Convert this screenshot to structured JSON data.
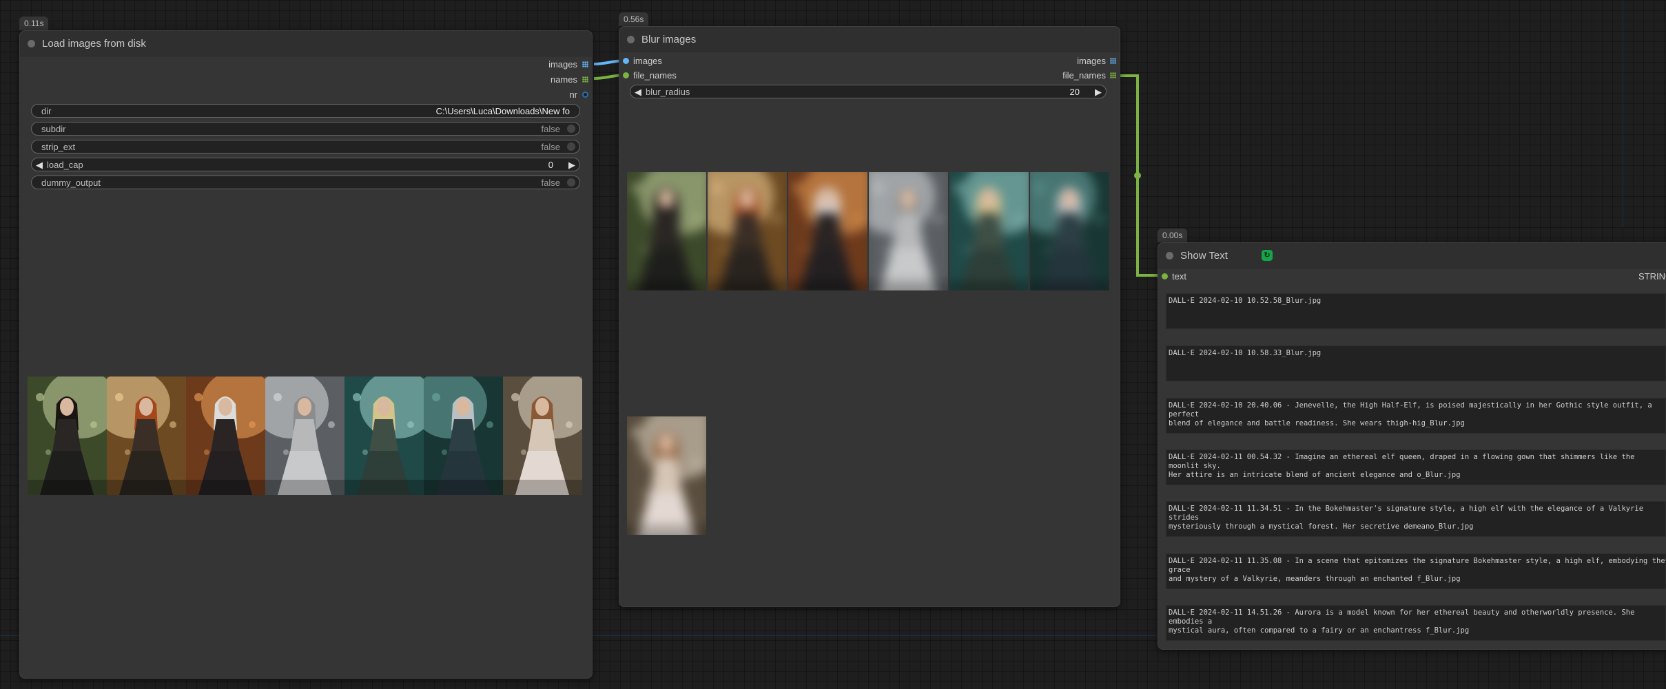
{
  "load_node": {
    "timing": "0.11s",
    "title": "Load images from disk",
    "outputs": [
      {
        "label": "images",
        "color": "#64b5f6"
      },
      {
        "label": "names",
        "color": "#7cb342"
      },
      {
        "label": "nr",
        "color": "#2a6fb0"
      }
    ],
    "widgets": {
      "dir": {
        "label": "dir",
        "value": "C:\\Users\\Luca\\Downloads\\New fo"
      },
      "subdir": {
        "label": "subdir",
        "value": "false"
      },
      "strip_ext": {
        "label": "strip_ext",
        "value": "false"
      },
      "load_cap": {
        "label": "load_cap",
        "value": "0"
      },
      "dummy_output": {
        "label": "dummy_output",
        "value": "false"
      }
    },
    "preview_count": 7
  },
  "blur_node": {
    "timing": "0.56s",
    "title": "Blur images",
    "inputs": [
      {
        "label": "images"
      },
      {
        "label": "file_names"
      }
    ],
    "outputs": [
      {
        "label": "images"
      },
      {
        "label": "file_names"
      }
    ],
    "widgets": {
      "blur_radius": {
        "label": "blur_radius",
        "value": "20"
      }
    },
    "preview_count": 7
  },
  "show_text_node": {
    "timing": "0.00s",
    "title": "Show Text",
    "badge_icon": "custom-scripts-icon",
    "input_label": "text",
    "output_label": "STRING",
    "texts": [
      "DALL·E 2024-02-10 10.52.58_Blur.jpg",
      "DALL·E 2024-02-10 10.58.33_Blur.jpg",
      "DALL·E 2024-02-10 20.40.06 - Jenevelle, the High Half-Elf, is poised majestically in her Gothic style outfit, a perfect\nblend of elegance and battle readiness. She wears thigh-hig_Blur.jpg",
      "DALL·E 2024-02-11 00.54.32 - Imagine an ethereal elf queen, draped in a flowing gown that shimmers like the moonlit sky.\nHer attire is an intricate blend of ancient elegance and o_Blur.jpg",
      "DALL·E 2024-02-11 11.34.51 - In the Bokehmaster's signature style, a high elf with the elegance of a Valkyrie strides\nmysteriously through a mystical forest. Her secretive demeano_Blur.jpg",
      "DALL·E 2024-02-11 11.35.08 - In a scene that epitomizes the signature Bokehmaster style, a high elf, embodying the grace\nand mystery of a Valkyrie, meanders through an enchanted f_Blur.jpg",
      "DALL·E 2024-02-11 14.51.26 - Aurora is a model known for her ethereal beauty and otherworldly presence. She embodies a\nmystical aura, often compared to a fairy or an enchantress f_Blur.jpg"
    ]
  },
  "colors": {
    "image_link": "#64b5f6",
    "string_link": "#7cb342",
    "int_slot": "#2a6fb0",
    "canvas": "#1e1e1e",
    "node_bg": "#353535"
  },
  "thumbnails": [
    {
      "bg": "#3d4a2a",
      "light": "#c9d6a0",
      "figure": "#2a2624",
      "hair": "#1a1412",
      "dress": "#1e1f1c"
    },
    {
      "bg": "#6d4a22",
      "light": "#f5d49a",
      "figure": "#3a2e26",
      "hair": "#a4471c",
      "dress": "#2a241f"
    },
    {
      "bg": "#6e3a1c",
      "light": "#f0a45a",
      "figure": "#2a2424",
      "hair": "#dcdcdc",
      "dress": "#242022"
    },
    {
      "bg": "#5b5f63",
      "light": "#d8dde0",
      "figure": "#b6b8ba",
      "hair": "#8c8c8c",
      "dress": "#c7c9cb"
    },
    {
      "bg": "#1f4a48",
      "light": "#9fd6cf",
      "figure": "#3f4f45",
      "hair": "#d4c48a",
      "dress": "#2e3f39"
    },
    {
      "bg": "#183734",
      "light": "#6fa9a5",
      "figure": "#2c3f44",
      "hair": "#b8c0c4",
      "dress": "#24353c"
    },
    {
      "bg": "#5a4e3e",
      "light": "#e9dccb",
      "figure": "#d6c6b6",
      "hair": "#8a5a36",
      "dress": "#e3d8d2"
    }
  ]
}
